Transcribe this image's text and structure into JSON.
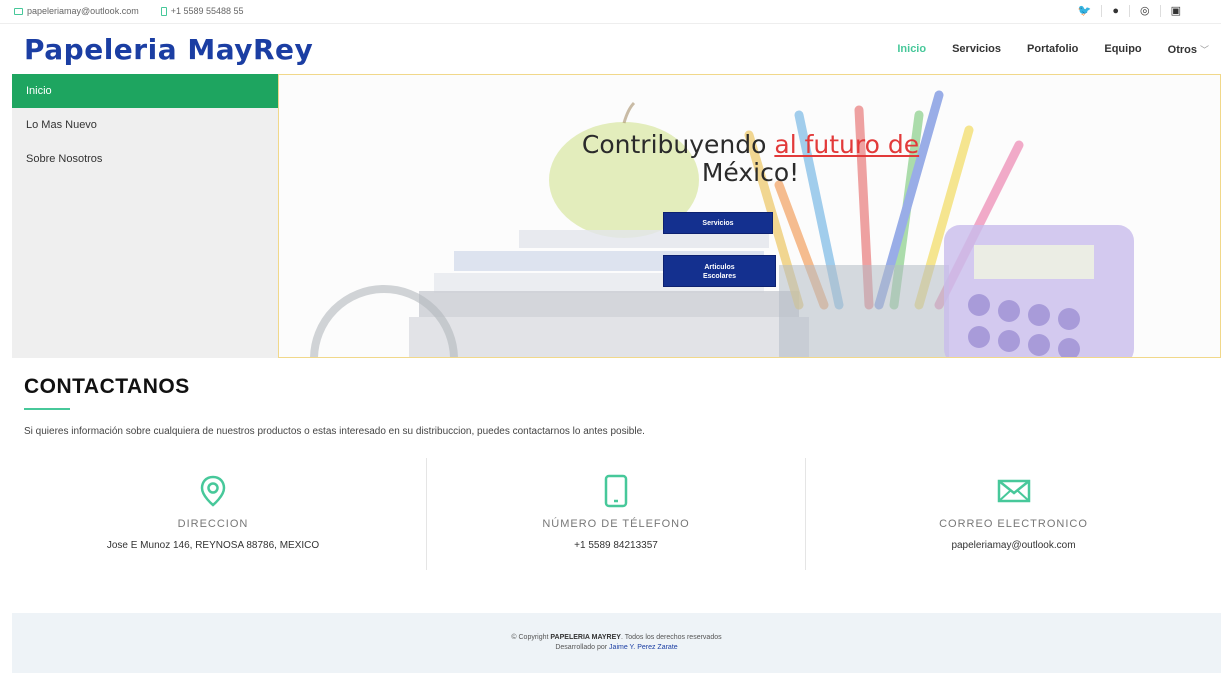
{
  "topbar": {
    "email": "papeleriamay@outlook.com",
    "phone": "+1 5589 55488 55",
    "social": [
      "twitter-icon",
      "github-icon",
      "instagram-icon",
      "linkedin-icon"
    ]
  },
  "header": {
    "logo": "Papeleria MayRey",
    "nav": [
      {
        "label": "Inicio",
        "active": true
      },
      {
        "label": "Servicios"
      },
      {
        "label": "Portafolio"
      },
      {
        "label": "Equipo"
      },
      {
        "label": "Otros"
      }
    ]
  },
  "sidebar": {
    "items": [
      {
        "label": "Inicio",
        "active": true
      },
      {
        "label": "Lo Mas Nuevo"
      },
      {
        "label": "Sobre Nosotros"
      }
    ]
  },
  "hero": {
    "headline_pre": "Contribuyendo",
    "headline_highlight": "al futuro de",
    "headline_post": "México!",
    "button1": "Servicios",
    "button2_line1": "Articulos",
    "button2_line2": "Escolares"
  },
  "contact": {
    "title": "CONTACTANOS",
    "description": "Si quieres información sobre cualquiera de nuestros productos o estas interesado en su distribuccion, puedes contactarnos lo antes posible.",
    "columns": [
      {
        "icon": "location-pin-icon",
        "label": "DIRECCION",
        "value": "Jose E Munoz 146, REYNOSA 88786, MEXICO"
      },
      {
        "icon": "phone-icon",
        "label": "NÚMERO DE TÉLEFONO",
        "value": "+1 5589 84213357"
      },
      {
        "icon": "envelope-icon",
        "label": "CORREO ELECTRONICO",
        "value": "papeleriamay@outlook.com"
      }
    ]
  },
  "footer": {
    "copyright_pre": "© Copyright",
    "brand": "PAPELERIA MAYREY",
    "copyright_post": ". Todos los derechos reservados",
    "developed_pre": "Desarrollado por",
    "developer": "Jaime Y. Perez Zarate"
  },
  "colors": {
    "brand_blue": "#1b3ea3",
    "accent_green": "#47c89a",
    "sidebar_active": "#1ea560",
    "highlight_red": "#e23a3a"
  }
}
